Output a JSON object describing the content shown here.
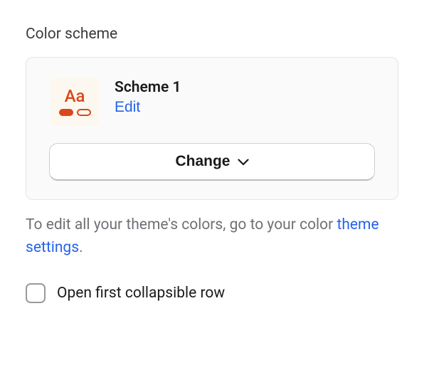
{
  "section": {
    "title": "Color scheme"
  },
  "scheme": {
    "swatch_text": "Aa",
    "name": "Scheme 1",
    "edit_label": "Edit",
    "change_label": "Change"
  },
  "helper": {
    "text_before": "To edit all your theme's colors, go to your color ",
    "link_text": "theme settings",
    "text_after": "."
  },
  "checkbox": {
    "label": "Open first collapsible row"
  }
}
